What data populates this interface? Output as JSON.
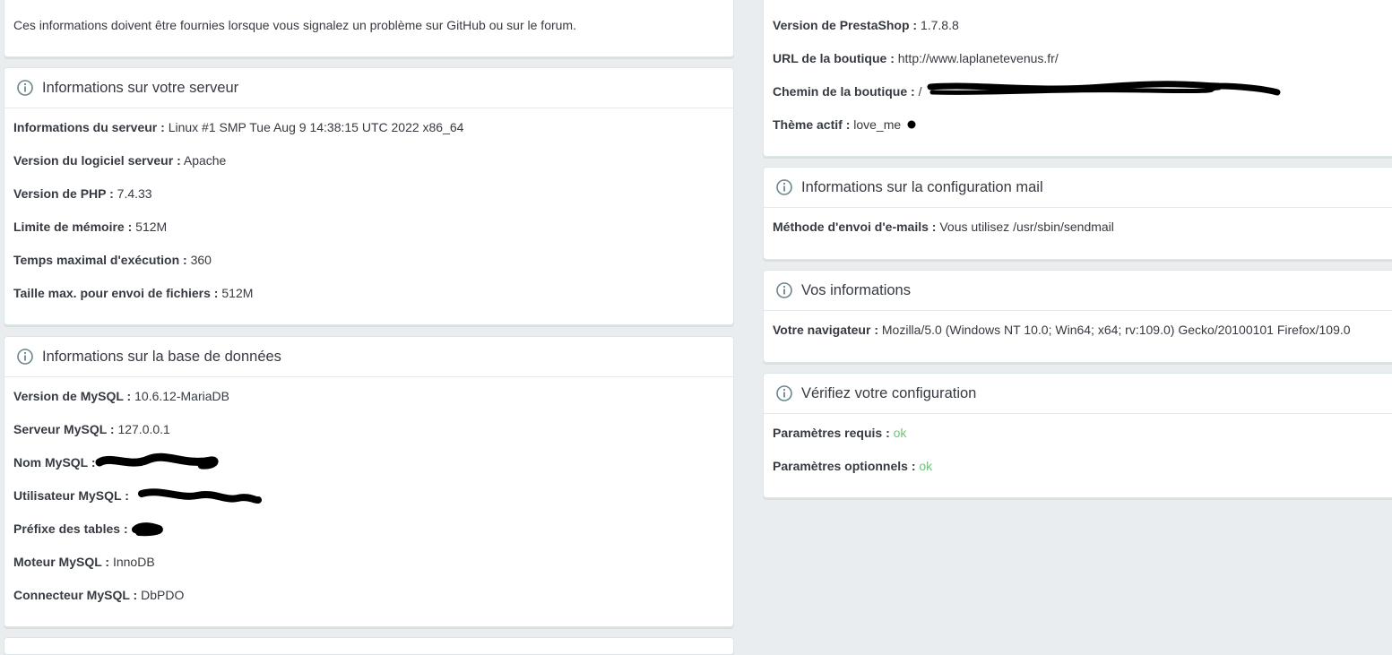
{
  "intro": {
    "text": "Ces informations doivent être fournies lorsque vous signalez un problème sur GitHub ou sur le forum."
  },
  "server": {
    "title": "Informations sur votre serveur",
    "rows": [
      {
        "label": "Informations du serveur :",
        "value": "Linux #1 SMP Tue Aug 9 14:38:15 UTC 2022 x86_64"
      },
      {
        "label": "Version du logiciel serveur :",
        "value": "Apache"
      },
      {
        "label": "Version de PHP :",
        "value": "7.4.33"
      },
      {
        "label": "Limite de mémoire :",
        "value": "512M"
      },
      {
        "label": "Temps maximal d'exécution :",
        "value": "360"
      },
      {
        "label": "Taille max. pour envoi de fichiers :",
        "value": "512M"
      }
    ]
  },
  "database": {
    "title": "Informations sur la base de données",
    "rows": [
      {
        "label": "Version de MySQL :",
        "value": "10.6.12-MariaDB"
      },
      {
        "label": "Serveur MySQL :",
        "value": "127.0.0.1"
      },
      {
        "label": "Nom MySQL :",
        "value": ""
      },
      {
        "label": "Utilisateur MySQL :",
        "value": ""
      },
      {
        "label": "Préfixe des tables :",
        "value": ""
      },
      {
        "label": "Moteur MySQL :",
        "value": "InnoDB"
      },
      {
        "label": "Connecteur MySQL :",
        "value": "DbPDO"
      }
    ]
  },
  "shop": {
    "rows": [
      {
        "label": "Version de PrestaShop :",
        "value": "1.7.8.8"
      },
      {
        "label": "URL de la boutique :",
        "value": "http://www.laplanetevenus.fr/"
      },
      {
        "label": "Chemin de la boutique :",
        "value": "/"
      },
      {
        "label": "Thème actif :",
        "value": "love_me"
      }
    ]
  },
  "mail": {
    "title": "Informations sur la configuration mail",
    "rows": [
      {
        "label": "Méthode d'envoi d'e-mails :",
        "value": "Vous utilisez /usr/sbin/sendmail"
      }
    ]
  },
  "you": {
    "title": "Vos informations",
    "rows": [
      {
        "label": "Votre navigateur :",
        "value": "Mozilla/5.0 (Windows NT 10.0; Win64; x64; rv:109.0) Gecko/20100101 Firefox/109.0"
      }
    ]
  },
  "check": {
    "title": "Vérifiez votre configuration",
    "rows": [
      {
        "label": "Paramètres requis :",
        "value": "ok"
      },
      {
        "label": "Paramètres optionnels :",
        "value": "ok"
      }
    ]
  },
  "colors": {
    "background": "#eaedef",
    "panel": "#ffffff",
    "ok": "#72c279",
    "icon": "#6c868e"
  },
  "icons": {
    "panel_heading": "info-circle-icon"
  }
}
